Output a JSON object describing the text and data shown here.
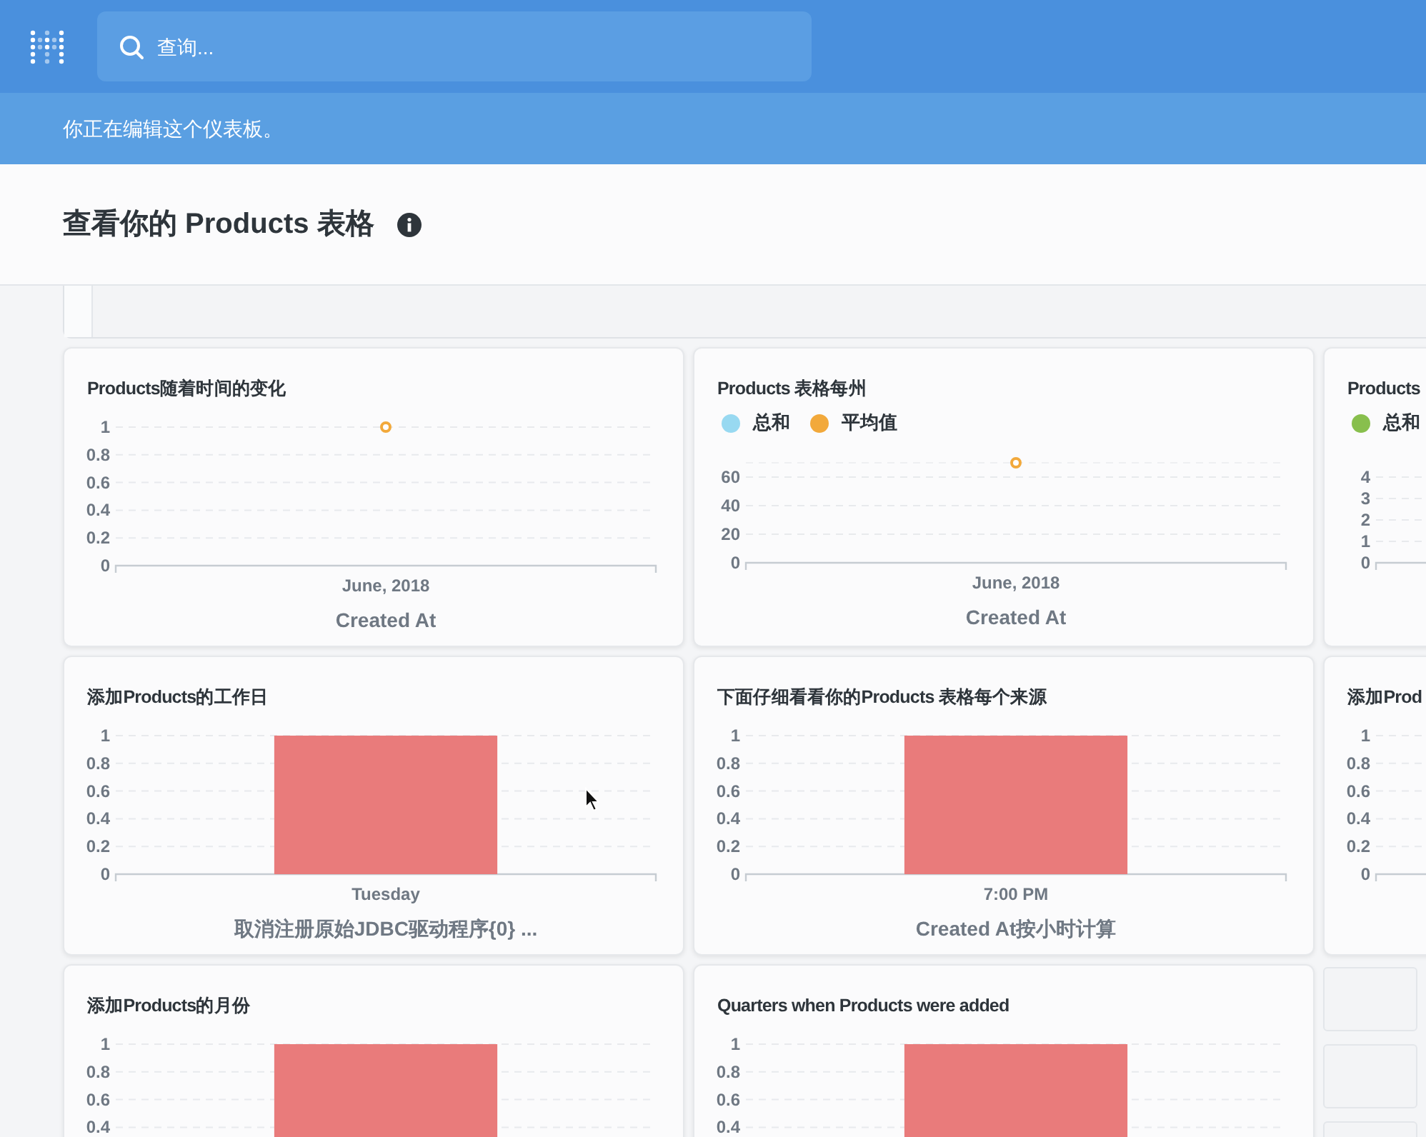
{
  "header": {
    "search": {
      "placeholder": "查询..."
    }
  },
  "edit_banner": "你正在编辑这个仪表板。",
  "dashboard": {
    "title": "查看你的 Products 表格"
  },
  "cards": [
    {
      "kind": "chart",
      "title": "Products随着时间的变化",
      "chart_data": {
        "type": "line",
        "xlabel": "Created At",
        "categories": [
          "June, 2018"
        ],
        "ylim": [
          0,
          1
        ],
        "yticks": [
          0,
          0.2,
          0.4,
          0.6,
          0.8,
          1
        ],
        "grid": true,
        "series": [
          {
            "color": "#f2a93b",
            "marker": true,
            "values": [
              1
            ]
          }
        ]
      }
    },
    {
      "kind": "chart",
      "title": "Products 表格每州",
      "chart_data": {
        "type": "line",
        "xlabel": "Created At",
        "categories": [
          "June, 2018"
        ],
        "ylim": [
          0,
          70
        ],
        "yticks": [
          0,
          20,
          40,
          60
        ],
        "grid": true,
        "series": [
          {
            "name": "总和",
            "color": "#98d9f1",
            "values": [
              null
            ]
          },
          {
            "name": "平均值",
            "color": "#f2a93b",
            "marker": true,
            "values": [
              70
            ]
          }
        ]
      }
    },
    {
      "kind": "chart",
      "title": "Products",
      "chart_data": {
        "type": "line",
        "ylim": [
          0,
          4
        ],
        "yticks": [
          0,
          1,
          2,
          3,
          4
        ],
        "grid": true,
        "series": [
          {
            "name": "总和",
            "color": "#88bf4d",
            "values": [
              null
            ]
          }
        ]
      }
    },
    {
      "kind": "chart",
      "title": "添加Products的工作日",
      "chart_data": {
        "type": "bar",
        "xlabel": "取消注册原始JDBC驱动程序{0} ...",
        "categories": [
          "Tuesday"
        ],
        "ylim": [
          0,
          1
        ],
        "yticks": [
          0,
          0.2,
          0.4,
          0.6,
          0.8,
          1
        ],
        "grid": true,
        "series": [
          {
            "color": "#e97b7b",
            "values": [
              1
            ]
          }
        ]
      }
    },
    {
      "kind": "chart",
      "title": "下面仔细看看你的Products 表格每个来源",
      "chart_data": {
        "type": "bar",
        "xlabel": "Created At按小时计算",
        "categories": [
          "7:00 PM"
        ],
        "ylim": [
          0,
          1
        ],
        "yticks": [
          0,
          0.2,
          0.4,
          0.6,
          0.8,
          1
        ],
        "grid": true,
        "series": [
          {
            "color": "#e97b7b",
            "values": [
              1
            ]
          }
        ]
      }
    },
    {
      "kind": "chart",
      "title": "添加Prod",
      "chart_data": {
        "type": "bar",
        "ylim": [
          0,
          1
        ],
        "yticks": [
          0,
          0.2,
          0.4,
          0.6,
          0.8,
          1
        ],
        "grid": true,
        "series": [
          {
            "values": [
              null
            ]
          }
        ]
      }
    },
    {
      "kind": "chart",
      "title": "添加Products的月份",
      "chart_data": {
        "type": "bar",
        "ylim": [
          0,
          1
        ],
        "yticks": [
          0.4,
          0.6,
          0.8,
          1
        ],
        "grid": true,
        "series": [
          {
            "color": "#e97b7b",
            "values": [
              1
            ]
          }
        ]
      }
    },
    {
      "kind": "chart",
      "title": "Quarters when Products were added",
      "chart_data": {
        "type": "bar",
        "ylim": [
          0,
          1
        ],
        "yticks": [
          0.4,
          0.6,
          0.8,
          1
        ],
        "grid": true,
        "series": [
          {
            "color": "#e97b7b",
            "values": [
              1
            ]
          }
        ]
      }
    },
    {
      "kind": "placeholder"
    }
  ]
}
